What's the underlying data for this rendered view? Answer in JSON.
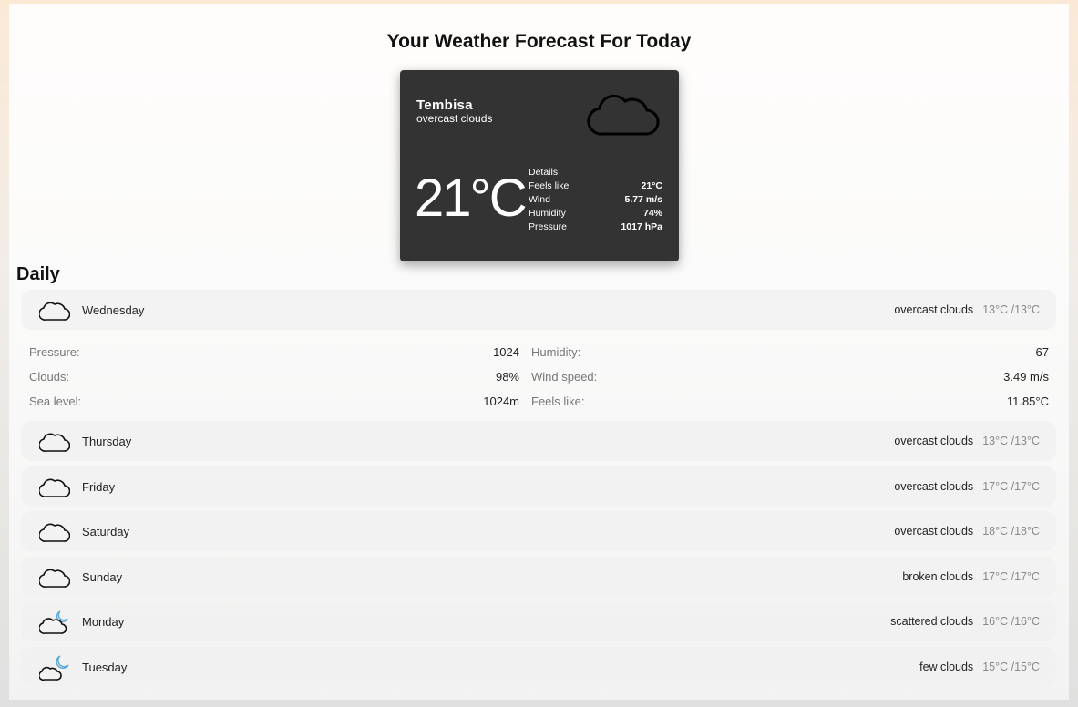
{
  "page": {
    "title": "Your Weather Forecast For Today"
  },
  "current": {
    "city": "Tembisa",
    "description": "overcast clouds",
    "icon": "cloud-icon",
    "temperature": "21°C",
    "details_heading": "Details",
    "details": [
      {
        "label": "Feels like",
        "value": "21°C"
      },
      {
        "label": "Wind",
        "value": "5.77 m/s"
      },
      {
        "label": "Humidity",
        "value": "74%"
      },
      {
        "label": "Pressure",
        "value": "1017 hPa"
      }
    ]
  },
  "daily": {
    "heading": "Daily",
    "days": [
      {
        "day": "Wednesday",
        "desc": "overcast clouds",
        "temp": "13°C /13°C",
        "icon": "cloud-icon"
      },
      {
        "day": "Thursday",
        "desc": "overcast clouds",
        "temp": "13°C /13°C",
        "icon": "cloud-icon"
      },
      {
        "day": "Friday",
        "desc": "overcast clouds",
        "temp": "17°C /17°C",
        "icon": "cloud-icon"
      },
      {
        "day": "Saturday",
        "desc": "overcast clouds",
        "temp": "18°C /18°C",
        "icon": "cloud-icon"
      },
      {
        "day": "Sunday",
        "desc": "broken clouds",
        "temp": "17°C /17°C",
        "icon": "cloud-icon"
      },
      {
        "day": "Monday",
        "desc": "scattered clouds",
        "temp": "16°C /16°C",
        "icon": "cloud-moon-icon"
      },
      {
        "day": "Tuesday",
        "desc": "few clouds",
        "temp": "15°C /15°C",
        "icon": "cloud-moon-icon"
      }
    ],
    "expanded": {
      "left": [
        {
          "label": "Pressure:",
          "value": "1024"
        },
        {
          "label": "Clouds:",
          "value": "98%"
        },
        {
          "label": "Sea level:",
          "value": "1024m"
        }
      ],
      "right": [
        {
          "label": "Humidity:",
          "value": "67"
        },
        {
          "label": "Wind speed:",
          "value": "3.49 m/s"
        },
        {
          "label": "Feels like:",
          "value": "11.85°C"
        }
      ]
    }
  },
  "colors": {
    "card_bg": "#333333",
    "moon_accent": "#5aa9d6"
  }
}
